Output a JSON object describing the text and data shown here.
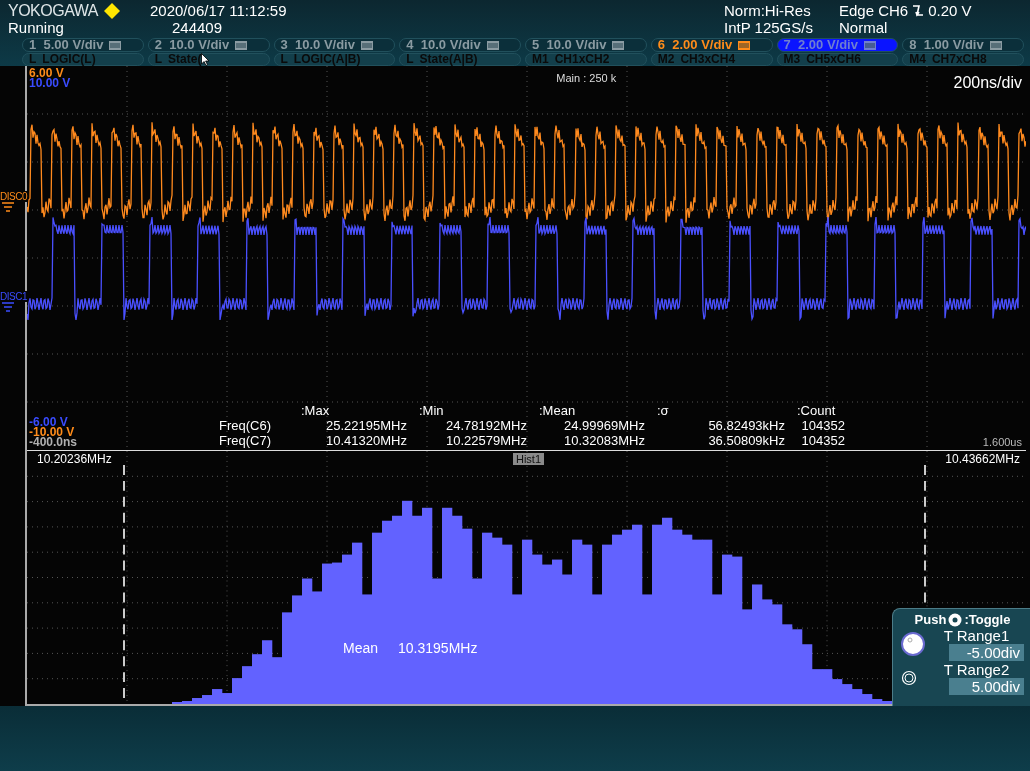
{
  "header": {
    "brand": "YOKOGAWA",
    "datetime": "2020/06/17 11:12:59",
    "status": "Running",
    "count": "244409",
    "acq_mode": "Norm:Hi-Res",
    "sample_rate": "IntP 125GS/s",
    "trigger_source": "Edge CH6",
    "trigger_level": "0.20 V",
    "trigger_mode": "Normal"
  },
  "channels": [
    {
      "number": "1",
      "scale": "5.00 V/div",
      "color": "#8a9ba2",
      "selected": false
    },
    {
      "number": "2",
      "scale": "10.0 V/div",
      "color": "#8a9ba2",
      "selected": false
    },
    {
      "number": "3",
      "scale": "10.0 V/div",
      "color": "#8a9ba2",
      "selected": false
    },
    {
      "number": "4",
      "scale": "10.0 V/div",
      "color": "#8a9ba2",
      "selected": false
    },
    {
      "number": "5",
      "scale": "10.0 V/div",
      "color": "#8a9ba2",
      "selected": false
    },
    {
      "number": "6",
      "scale": "2.00 V/div",
      "color": "#ff8c1a",
      "selected": false
    },
    {
      "number": "7",
      "scale": "2.00 V/div",
      "color": "#6f7fd0",
      "selected": true
    },
    {
      "number": "8",
      "scale": "1.00 V/div",
      "color": "#8a9ba2",
      "selected": false
    }
  ],
  "logic_math": [
    {
      "tag": "L",
      "label": "LOGIC(L)"
    },
    {
      "tag": "L",
      "label": "State("
    },
    {
      "tag": "L",
      "label": "LOGIC(A|B)"
    },
    {
      "tag": "L",
      "label": "State(A|B)"
    },
    {
      "tag": "M1",
      "label": "CH1xCH2"
    },
    {
      "tag": "M2",
      "label": "CH3xCH4"
    },
    {
      "tag": "M3",
      "label": "CH5xCH6"
    },
    {
      "tag": "M4",
      "label": "CH7xCH8"
    }
  ],
  "waveform": {
    "levels_top": [
      {
        "text": "6.00 V",
        "color": "#ff8c1a"
      },
      {
        "text": "10.00 V",
        "color": "#3a4cff"
      }
    ],
    "zoom_label": "Main : 250 k",
    "time_div": "200ns/div",
    "markers": [
      {
        "label": "DISC0",
        "color": "#ff8c1a"
      },
      {
        "label": "DISC1",
        "color": "#3a4cff"
      }
    ],
    "levels_bottom": [
      {
        "text": "-6.00 V",
        "color": "#3a4cff"
      },
      {
        "text": "-10.00 V",
        "color": "#ff8c1a"
      },
      {
        "text": "-400.0ns",
        "color": "#b0b0b0"
      }
    ],
    "time_end": "1.600us"
  },
  "measurements": {
    "columns": [
      ":Max",
      ":Min",
      ":Mean",
      ":σ",
      ":Count"
    ],
    "rows": [
      {
        "name": "Freq(C6)",
        "values": [
          "25.22195MHz",
          "24.78192MHz",
          "24.99969MHz",
          "56.82493kHz",
          "104352"
        ]
      },
      {
        "name": "Freq(C7)",
        "values": [
          "10.41320MHz",
          "10.22579MHz",
          "10.32083MHz",
          "36.50809kHz",
          "104352"
        ]
      }
    ]
  },
  "histogram": {
    "left_cursor": "10.20236MHz",
    "title": "Hist1",
    "right_cursor": "10.43662MHz",
    "mean_label": "Mean",
    "mean_value": "10.3195MHz"
  },
  "knob_panel": {
    "push": "Push",
    "toggle": ":Toggle",
    "ranges": [
      {
        "label": "T Range1",
        "value": "-5.00div",
        "selected": true
      },
      {
        "label": "T Range2",
        "value": "5.00div",
        "selected": false
      }
    ]
  }
}
